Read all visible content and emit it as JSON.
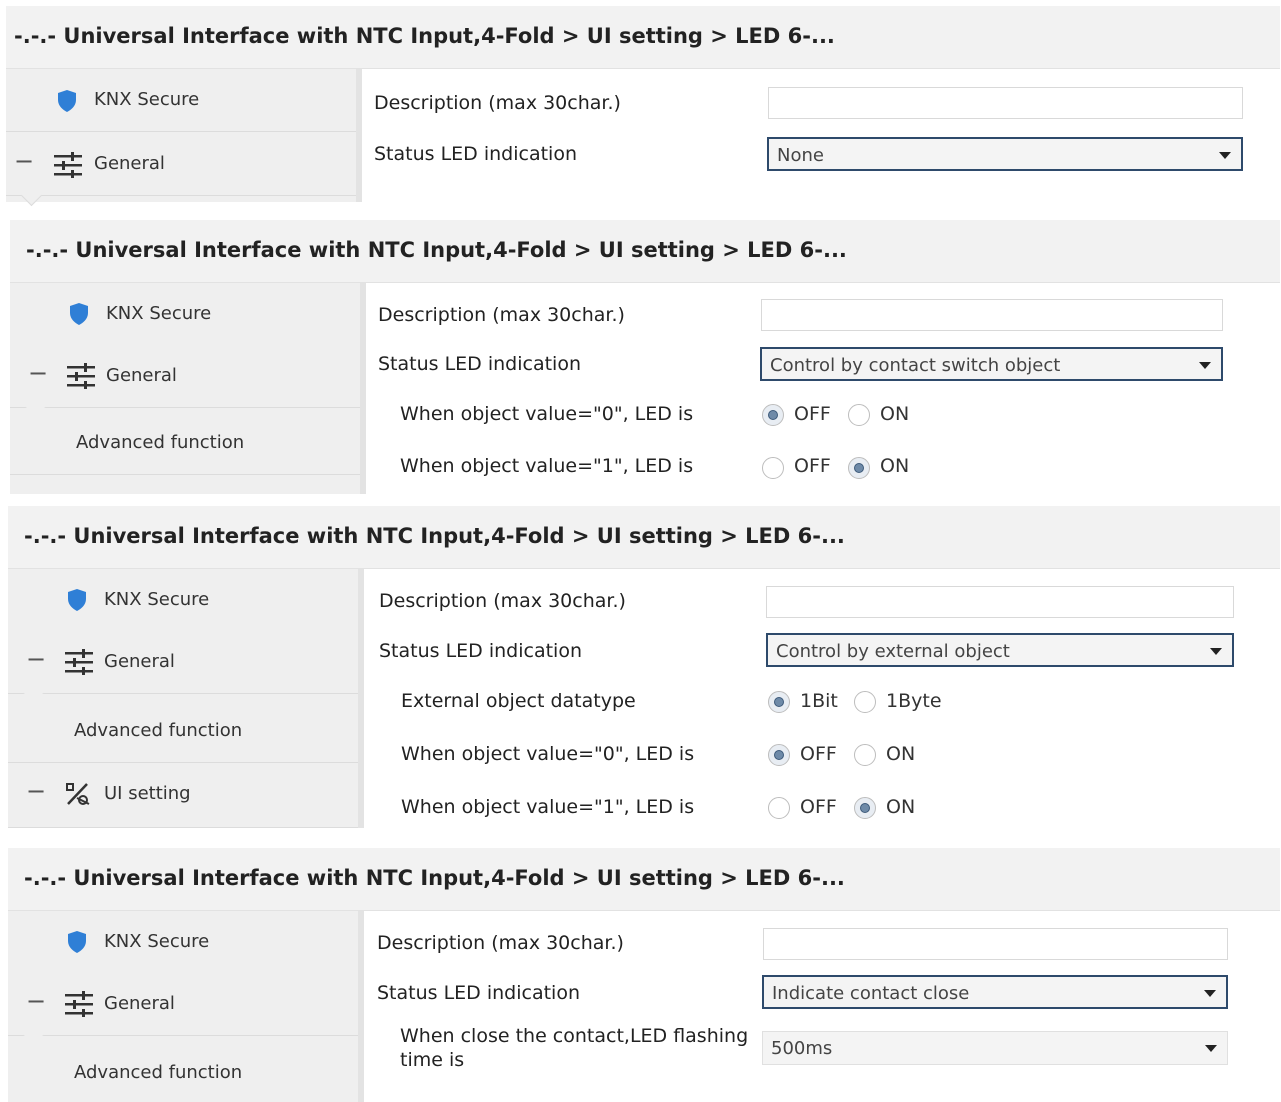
{
  "common": {
    "breadcrumb": "-.-.- Universal Interface with NTC Input,4-Fold > UI setting > LED 6-...",
    "knx_secure": "KNX Secure",
    "general": "General",
    "advanced_function": "Advanced function",
    "ui_setting": "UI setting",
    "minus": "−",
    "description_label": "Description (max 30char.)",
    "status_led_label": "Status LED indication"
  },
  "panel1": {
    "status_led_value": "None"
  },
  "panel2": {
    "status_led_value": "Control by contact switch object",
    "row0_label": "When object value=\"0\", LED is",
    "row1_label": "When object value=\"1\", LED is",
    "off": "OFF",
    "on": "ON",
    "row0_selected": "OFF",
    "row1_selected": "ON"
  },
  "panel3": {
    "status_led_value": "Control by external object",
    "datatype_label": "External object datatype",
    "opt_1bit": "1Bit",
    "opt_1byte": "1Byte",
    "datatype_selected": "1Bit",
    "row0_label": "When object value=\"0\", LED is",
    "row1_label": "When object value=\"1\", LED is",
    "off": "OFF",
    "on": "ON",
    "row0_selected": "OFF",
    "row1_selected": "ON"
  },
  "panel4": {
    "status_led_value": "Indicate contact close",
    "flash_label_line1": "When close the contact,LED flashing",
    "flash_label_line2": "time is",
    "flash_value": "500ms"
  },
  "icons": {
    "secure": "shield-icon",
    "general": "sliders-icon",
    "ui": "ui-setting-icon"
  },
  "colors": {
    "shield": "#2f7fd6",
    "dropdown_border": "#2e4a6b",
    "radio_dot": "#6e8aa8"
  }
}
